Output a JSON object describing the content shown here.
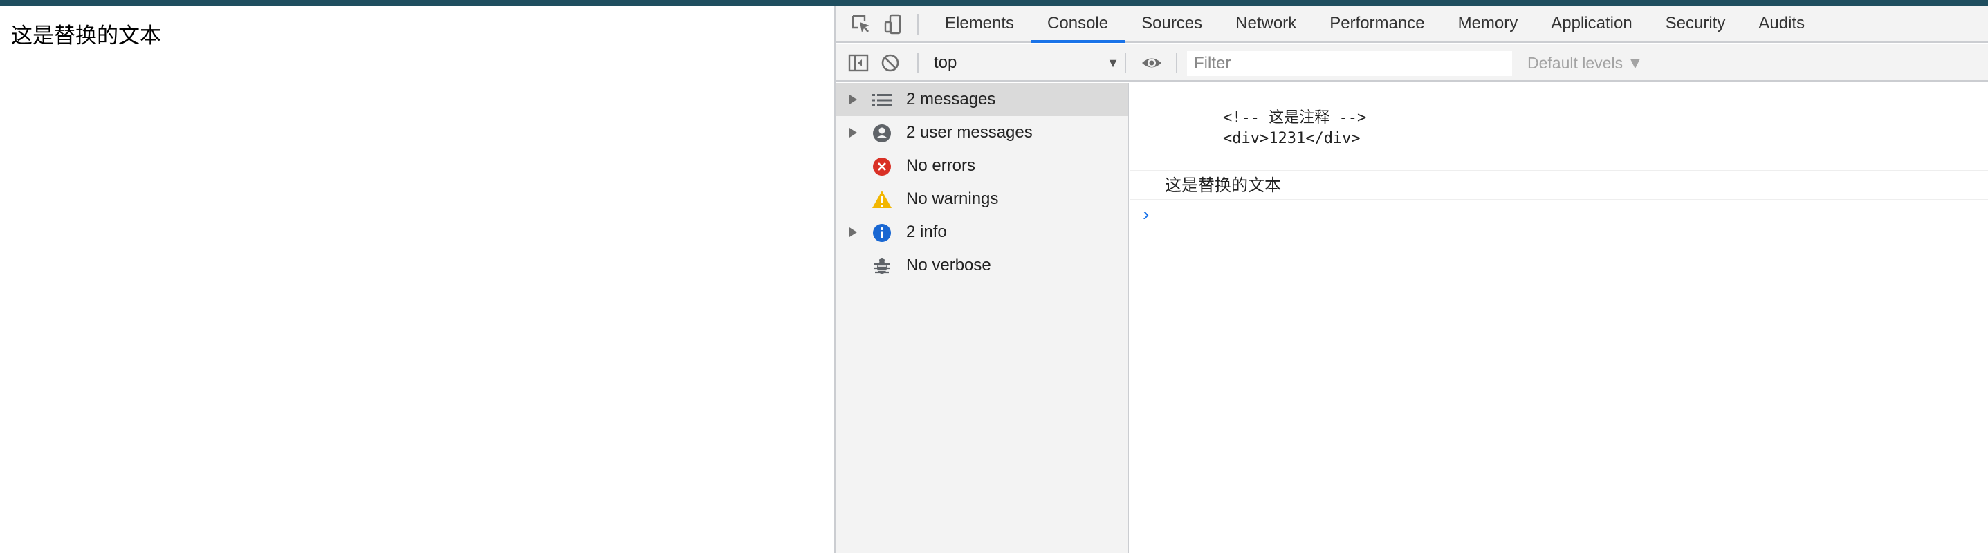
{
  "page": {
    "text": "这是替换的文本"
  },
  "devtools": {
    "tabs": [
      {
        "label": "Elements",
        "active": false
      },
      {
        "label": "Console",
        "active": true
      },
      {
        "label": "Sources",
        "active": false
      },
      {
        "label": "Network",
        "active": false
      },
      {
        "label": "Performance",
        "active": false
      },
      {
        "label": "Memory",
        "active": false
      },
      {
        "label": "Application",
        "active": false
      },
      {
        "label": "Security",
        "active": false
      },
      {
        "label": "Audits",
        "active": false
      }
    ],
    "toolbar": {
      "context": "top",
      "filter_placeholder": "Filter",
      "levels": "Default levels ▼"
    },
    "sidebar": {
      "items": [
        {
          "label": "2 messages",
          "icon": "list-icon",
          "expandable": true,
          "selected": true
        },
        {
          "label": "2 user messages",
          "icon": "user-icon",
          "expandable": true,
          "selected": false
        },
        {
          "label": "No errors",
          "icon": "error-icon",
          "expandable": false,
          "selected": false
        },
        {
          "label": "No warnings",
          "icon": "warning-icon",
          "expandable": false,
          "selected": false
        },
        {
          "label": "2 info",
          "icon": "info-icon",
          "expandable": true,
          "selected": false
        },
        {
          "label": "No verbose",
          "icon": "bug-icon",
          "expandable": false,
          "selected": false
        }
      ]
    },
    "console": {
      "messages": [
        {
          "text": "<!-- 这是注释 -->\n<div>1231</div>"
        },
        {
          "text": "这是替换的文本"
        }
      ],
      "prompt": "›"
    },
    "colors": {
      "accent": "#1a73e8",
      "error": "#d93025",
      "warning": "#f2b600",
      "info": "#1967d2"
    }
  }
}
